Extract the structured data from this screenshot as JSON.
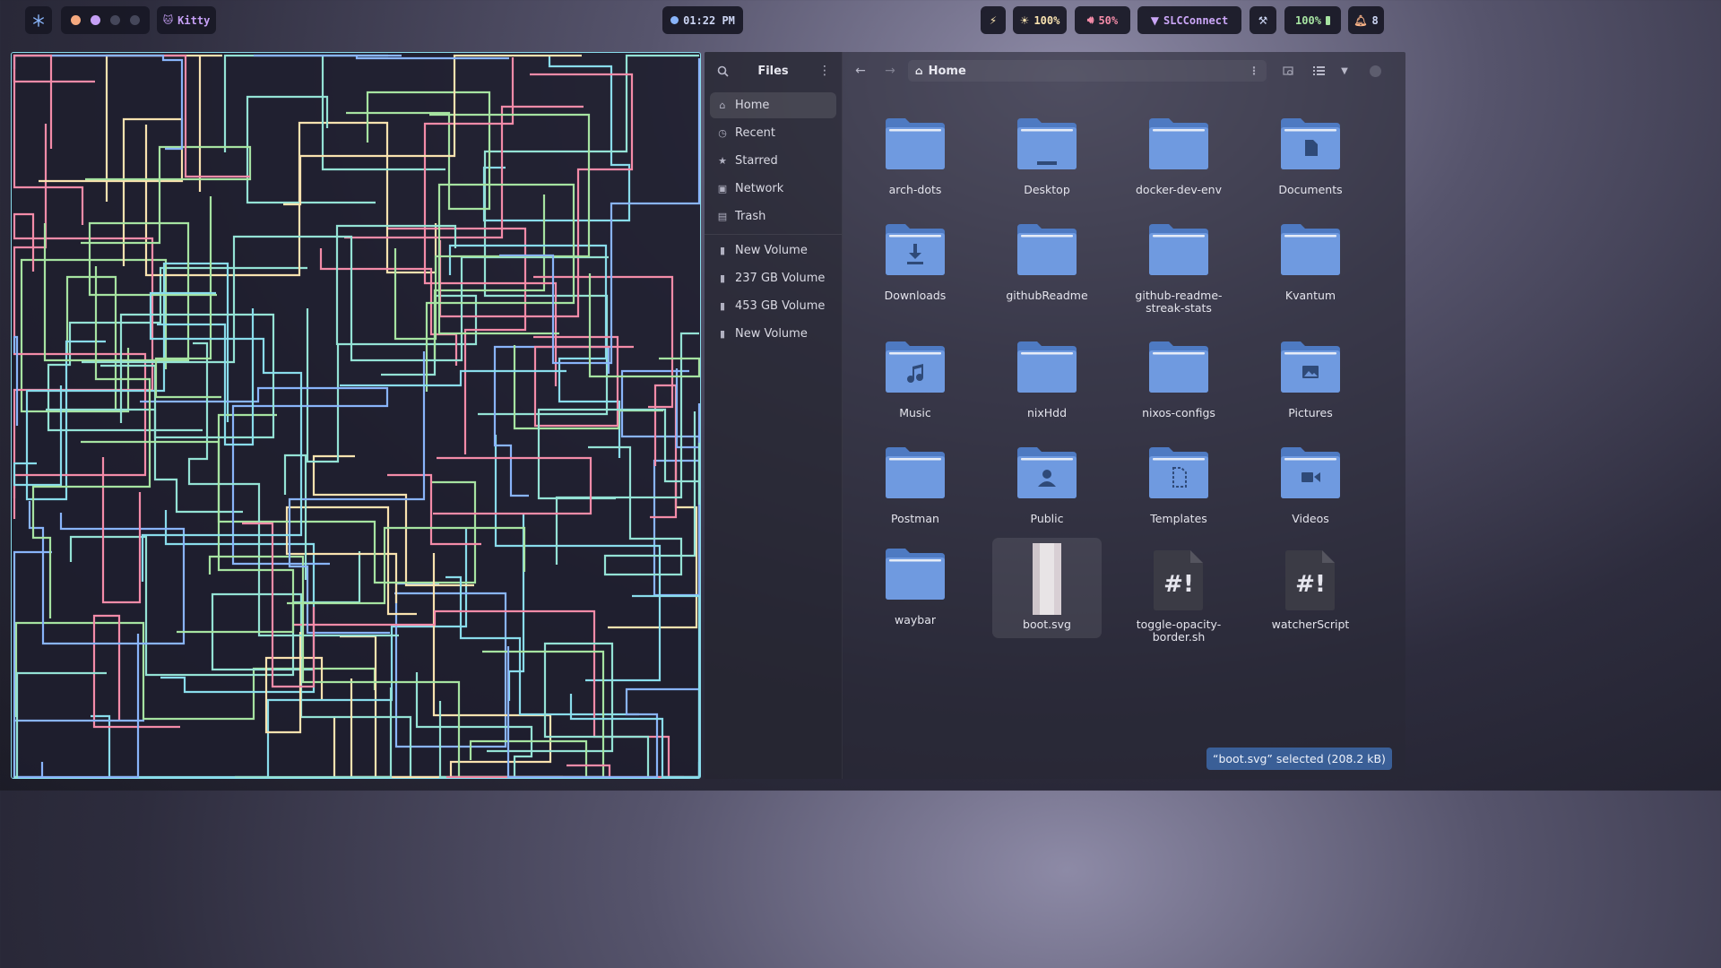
{
  "topbar": {
    "launcher_icon": "snowflake-icon",
    "window_label": "Kitty",
    "window_icon": "cat-icon",
    "workspace_dots": [
      "#f5a97f",
      "#c6a0f6",
      "#45475a",
      "#45475a"
    ],
    "clock": "01:22 PM",
    "power_icon": "bolt-icon",
    "brightness": "100%",
    "volume": "50%",
    "network": "SLCConnect",
    "tools_icon": "tools-icon",
    "battery": "100%",
    "notifications": "8"
  },
  "file_manager": {
    "title": "Files",
    "path": "Home",
    "sidebar": [
      {
        "label": "Home",
        "icon": "home-icon",
        "active": true
      },
      {
        "label": "Recent",
        "icon": "clock-icon"
      },
      {
        "label": "Starred",
        "icon": "star-icon"
      },
      {
        "label": "Network",
        "icon": "network-icon"
      },
      {
        "label": "Trash",
        "icon": "trash-icon"
      },
      {
        "label": "New Volume",
        "icon": "drive-icon"
      },
      {
        "label": "237 GB Volume",
        "icon": "drive-icon"
      },
      {
        "label": "453 GB Volume",
        "icon": "drive-icon"
      },
      {
        "label": "New Volume",
        "icon": "drive-icon"
      }
    ],
    "items": [
      {
        "name": "arch-dots",
        "kind": "folder"
      },
      {
        "name": "Desktop",
        "kind": "folder-desktop"
      },
      {
        "name": "docker-dev-env",
        "kind": "folder"
      },
      {
        "name": "Documents",
        "kind": "folder-documents"
      },
      {
        "name": "Downloads",
        "kind": "folder-downloads"
      },
      {
        "name": "githubReadme",
        "kind": "folder"
      },
      {
        "name": "github-readme-streak-stats",
        "kind": "folder"
      },
      {
        "name": "Kvantum",
        "kind": "folder"
      },
      {
        "name": "Music",
        "kind": "folder-music"
      },
      {
        "name": "nixHdd",
        "kind": "folder"
      },
      {
        "name": "nixos-configs",
        "kind": "folder"
      },
      {
        "name": "Pictures",
        "kind": "folder-pictures"
      },
      {
        "name": "Postman",
        "kind": "folder"
      },
      {
        "name": "Public",
        "kind": "folder-public"
      },
      {
        "name": "Templates",
        "kind": "folder-templates"
      },
      {
        "name": "Videos",
        "kind": "folder-videos"
      },
      {
        "name": "waybar",
        "kind": "folder"
      },
      {
        "name": "boot.svg",
        "kind": "image-file",
        "selected": true
      },
      {
        "name": "toggle-opacity-border.sh",
        "kind": "script-file"
      },
      {
        "name": "watcherScript",
        "kind": "script-file"
      }
    ],
    "status": "“boot.svg” selected  (208.2 kB)"
  }
}
